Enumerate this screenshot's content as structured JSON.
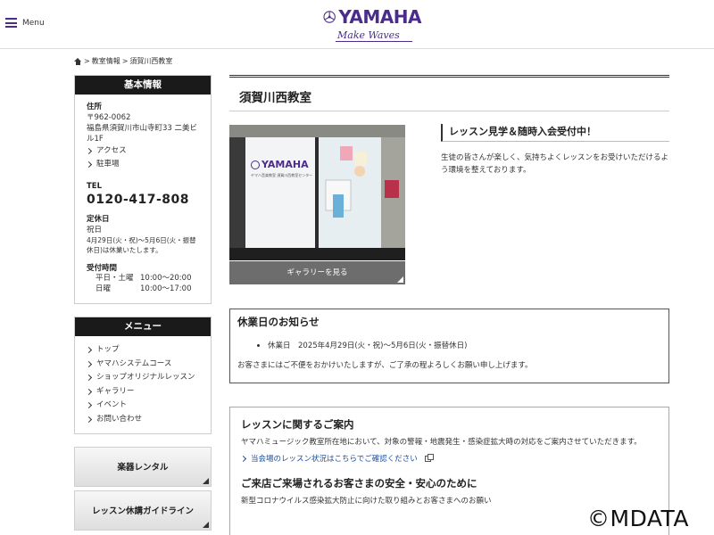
{
  "header": {
    "menu_label": "Menu",
    "logo_text": "YAMAHA",
    "logo_tagline": "Make Waves",
    "brand_color": "#4b2c8c"
  },
  "breadcrumb": {
    "home_icon": "home-icon",
    "items": [
      "教室情報",
      "須賀川西教室"
    ],
    "separator": ">"
  },
  "sidebar": {
    "info": {
      "heading": "基本情報",
      "address_label": "住所",
      "postal": "〒962-0062",
      "address": "福島県須賀川市山寺町33 二美ビル1F",
      "links": [
        "アクセス",
        "駐車場"
      ],
      "tel_label": "TEL",
      "tel": "0120-417-808",
      "closed_label": "定休日",
      "closed_value": "祝日",
      "closed_note": "4月29日(火・祝)〜5月6日(火・振替休日)は休業いたします。",
      "hours_label": "受付時間",
      "hours": [
        {
          "days": "平日・土曜",
          "time": "10:00〜20:00"
        },
        {
          "days": "日曜",
          "time": "10:00〜17:00"
        }
      ]
    },
    "menu": {
      "heading": "メニュー",
      "items": [
        "トップ",
        "ヤマハシステムコース",
        "ショップオリジナルレッスン",
        "ギャラリー",
        "イベント",
        "お問い合わせ"
      ]
    },
    "buttons": [
      "楽器レンタル",
      "レッスン休講ガイドライン"
    ]
  },
  "main": {
    "title": "須賀川西教室",
    "photo": {
      "sign_logo": "YAMAHA",
      "sign_sub": "ヤマハ音楽教室 須賀川西教室センター"
    },
    "gallery_button": "ギャラリーを見る",
    "promo": {
      "title": "レッスン見学＆随時入会受付中！",
      "text": "生徒の皆さんが楽しく、気持ちよくレッスンをお受けいただけるよう環境を整えております。"
    },
    "notice": {
      "title": "休業日のお知らせ",
      "item": "休業日　2025年4月29日(火・祝)〜5月6日(火・振替休日)",
      "note": "お客さまにはご不便をおかけいたしますが、ご了承の程よろしくお願い申し上げます。"
    },
    "lesson": {
      "title": "レッスンに関するご案内",
      "text": "ヤマハミュージック教室所在地において、対象の警報・地震発生・感染症拡大時の対応をご案内させていただきます。",
      "link": "当会場のレッスン状況はこちらでご確認ください",
      "title2": "ご来店ご来場されるお客さまの安全・安心のために",
      "text2": "新型コロナウイルス感染拡大防止に向けた取り組みとお客さまへのお願い"
    }
  },
  "watermark": "©MDATA"
}
